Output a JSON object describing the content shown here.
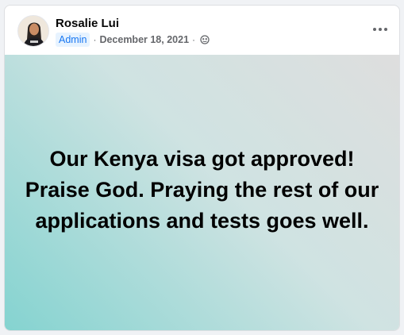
{
  "post": {
    "author": "Rosalie Lui",
    "role_badge": "Admin",
    "separator": "·",
    "date": "December 18, 2021",
    "privacy_icon": "globe-icon",
    "more_icon": "more-options-icon",
    "text": "Our Kenya visa got approved! Praise God. Praying the rest of our applications and tests goes well."
  },
  "colors": {
    "badge_text": "#1877f2",
    "badge_bg": "#e7f3ff",
    "background_gradient_start": "#dedede",
    "background_gradient_end": "#84d3d0"
  }
}
